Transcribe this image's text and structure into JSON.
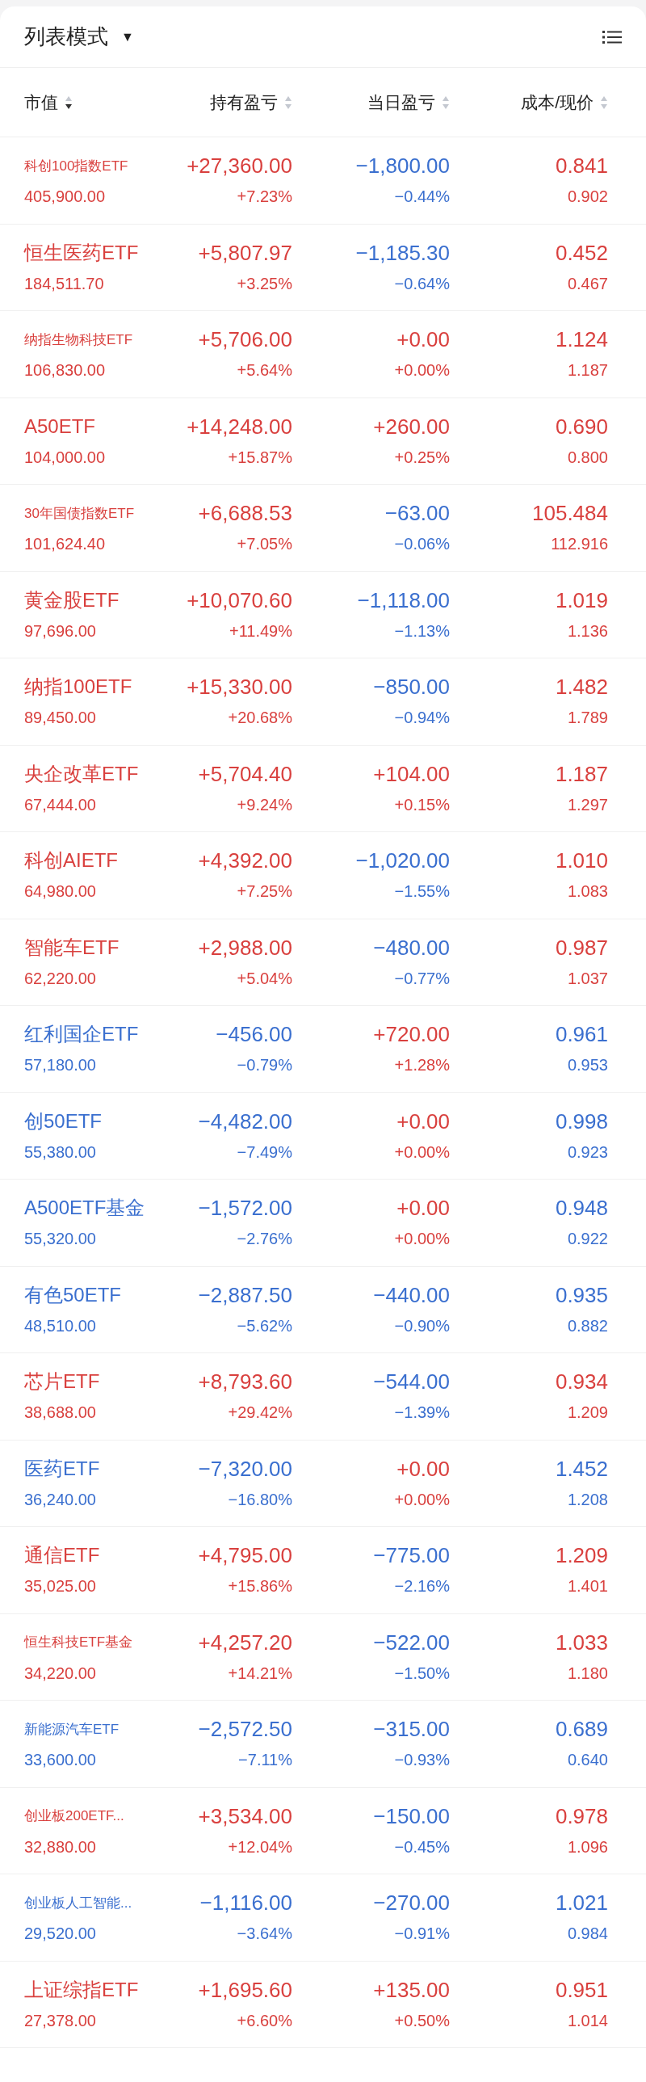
{
  "header": {
    "title": "列表模式",
    "dropdown_glyph": "▼"
  },
  "columns": [
    {
      "label": "市值",
      "sorted": true
    },
    {
      "label": "持有盈亏",
      "sorted": false
    },
    {
      "label": "当日盈亏",
      "sorted": false
    },
    {
      "label": "成本/现价",
      "sorted": false
    }
  ],
  "rows": [
    {
      "name": "科创100指数ETF",
      "market_value": "405,900.00",
      "hold_pnl": "+27,360.00",
      "hold_pct": "+7.23%",
      "hold_gain": true,
      "day_pnl": "−1,800.00",
      "day_pct": "−0.44%",
      "day_gain": false,
      "cost": "0.841",
      "price": "0.902",
      "price_gain": true
    },
    {
      "name": "恒生医药ETF",
      "market_value": "184,511.70",
      "hold_pnl": "+5,807.97",
      "hold_pct": "+3.25%",
      "hold_gain": true,
      "day_pnl": "−1,185.30",
      "day_pct": "−0.64%",
      "day_gain": false,
      "cost": "0.452",
      "price": "0.467",
      "price_gain": true
    },
    {
      "name": "纳指生物科技ETF",
      "market_value": "106,830.00",
      "hold_pnl": "+5,706.00",
      "hold_pct": "+5.64%",
      "hold_gain": true,
      "day_pnl": "+0.00",
      "day_pct": "+0.00%",
      "day_gain": true,
      "cost": "1.124",
      "price": "1.187",
      "price_gain": true
    },
    {
      "name": "A50ETF",
      "market_value": "104,000.00",
      "hold_pnl": "+14,248.00",
      "hold_pct": "+15.87%",
      "hold_gain": true,
      "day_pnl": "+260.00",
      "day_pct": "+0.25%",
      "day_gain": true,
      "cost": "0.690",
      "price": "0.800",
      "price_gain": true
    },
    {
      "name": "30年国债指数ETF",
      "market_value": "101,624.40",
      "hold_pnl": "+6,688.53",
      "hold_pct": "+7.05%",
      "hold_gain": true,
      "day_pnl": "−63.00",
      "day_pct": "−0.06%",
      "day_gain": false,
      "cost": "105.484",
      "price": "112.916",
      "price_gain": true
    },
    {
      "name": "黄金股ETF",
      "market_value": "97,696.00",
      "hold_pnl": "+10,070.60",
      "hold_pct": "+11.49%",
      "hold_gain": true,
      "day_pnl": "−1,118.00",
      "day_pct": "−1.13%",
      "day_gain": false,
      "cost": "1.019",
      "price": "1.136",
      "price_gain": true
    },
    {
      "name": "纳指100ETF",
      "market_value": "89,450.00",
      "hold_pnl": "+15,330.00",
      "hold_pct": "+20.68%",
      "hold_gain": true,
      "day_pnl": "−850.00",
      "day_pct": "−0.94%",
      "day_gain": false,
      "cost": "1.482",
      "price": "1.789",
      "price_gain": true
    },
    {
      "name": "央企改革ETF",
      "market_value": "67,444.00",
      "hold_pnl": "+5,704.40",
      "hold_pct": "+9.24%",
      "hold_gain": true,
      "day_pnl": "+104.00",
      "day_pct": "+0.15%",
      "day_gain": true,
      "cost": "1.187",
      "price": "1.297",
      "price_gain": true
    },
    {
      "name": "科创AIETF",
      "market_value": "64,980.00",
      "hold_pnl": "+4,392.00",
      "hold_pct": "+7.25%",
      "hold_gain": true,
      "day_pnl": "−1,020.00",
      "day_pct": "−1.55%",
      "day_gain": false,
      "cost": "1.010",
      "price": "1.083",
      "price_gain": true
    },
    {
      "name": "智能车ETF",
      "market_value": "62,220.00",
      "hold_pnl": "+2,988.00",
      "hold_pct": "+5.04%",
      "hold_gain": true,
      "day_pnl": "−480.00",
      "day_pct": "−0.77%",
      "day_gain": false,
      "cost": "0.987",
      "price": "1.037",
      "price_gain": true
    },
    {
      "name": "红利国企ETF",
      "market_value": "57,180.00",
      "hold_pnl": "−456.00",
      "hold_pct": "−0.79%",
      "hold_gain": false,
      "day_pnl": "+720.00",
      "day_pct": "+1.28%",
      "day_gain": true,
      "cost": "0.961",
      "price": "0.953",
      "price_gain": false
    },
    {
      "name": "创50ETF",
      "market_value": "55,380.00",
      "hold_pnl": "−4,482.00",
      "hold_pct": "−7.49%",
      "hold_gain": false,
      "day_pnl": "+0.00",
      "day_pct": "+0.00%",
      "day_gain": true,
      "cost": "0.998",
      "price": "0.923",
      "price_gain": false
    },
    {
      "name": "A500ETF基金",
      "market_value": "55,320.00",
      "hold_pnl": "−1,572.00",
      "hold_pct": "−2.76%",
      "hold_gain": false,
      "day_pnl": "+0.00",
      "day_pct": "+0.00%",
      "day_gain": true,
      "cost": "0.948",
      "price": "0.922",
      "price_gain": false
    },
    {
      "name": "有色50ETF",
      "market_value": "48,510.00",
      "hold_pnl": "−2,887.50",
      "hold_pct": "−5.62%",
      "hold_gain": false,
      "day_pnl": "−440.00",
      "day_pct": "−0.90%",
      "day_gain": false,
      "cost": "0.935",
      "price": "0.882",
      "price_gain": false
    },
    {
      "name": "芯片ETF",
      "market_value": "38,688.00",
      "hold_pnl": "+8,793.60",
      "hold_pct": "+29.42%",
      "hold_gain": true,
      "day_pnl": "−544.00",
      "day_pct": "−1.39%",
      "day_gain": false,
      "cost": "0.934",
      "price": "1.209",
      "price_gain": true
    },
    {
      "name": "医药ETF",
      "market_value": "36,240.00",
      "hold_pnl": "−7,320.00",
      "hold_pct": "−16.80%",
      "hold_gain": false,
      "day_pnl": "+0.00",
      "day_pct": "+0.00%",
      "day_gain": true,
      "cost": "1.452",
      "price": "1.208",
      "price_gain": false
    },
    {
      "name": "通信ETF",
      "market_value": "35,025.00",
      "hold_pnl": "+4,795.00",
      "hold_pct": "+15.86%",
      "hold_gain": true,
      "day_pnl": "−775.00",
      "day_pct": "−2.16%",
      "day_gain": false,
      "cost": "1.209",
      "price": "1.401",
      "price_gain": true
    },
    {
      "name": "恒生科技ETF基金",
      "market_value": "34,220.00",
      "hold_pnl": "+4,257.20",
      "hold_pct": "+14.21%",
      "hold_gain": true,
      "day_pnl": "−522.00",
      "day_pct": "−1.50%",
      "day_gain": false,
      "cost": "1.033",
      "price": "1.180",
      "price_gain": true
    },
    {
      "name": "新能源汽车ETF",
      "market_value": "33,600.00",
      "hold_pnl": "−2,572.50",
      "hold_pct": "−7.11%",
      "hold_gain": false,
      "day_pnl": "−315.00",
      "day_pct": "−0.93%",
      "day_gain": false,
      "cost": "0.689",
      "price": "0.640",
      "price_gain": false
    },
    {
      "name": "创业板200ETF...",
      "market_value": "32,880.00",
      "hold_pnl": "+3,534.00",
      "hold_pct": "+12.04%",
      "hold_gain": true,
      "day_pnl": "−150.00",
      "day_pct": "−0.45%",
      "day_gain": false,
      "cost": "0.978",
      "price": "1.096",
      "price_gain": true
    },
    {
      "name": "创业板人工智能...",
      "market_value": "29,520.00",
      "hold_pnl": "−1,116.00",
      "hold_pct": "−3.64%",
      "hold_gain": false,
      "day_pnl": "−270.00",
      "day_pct": "−0.91%",
      "day_gain": false,
      "cost": "1.021",
      "price": "0.984",
      "price_gain": false
    },
    {
      "name": "上证综指ETF",
      "market_value": "27,378.00",
      "hold_pnl": "+1,695.60",
      "hold_pct": "+6.60%",
      "hold_gain": true,
      "day_pnl": "+135.00",
      "day_pct": "+0.50%",
      "day_gain": true,
      "cost": "0.951",
      "price": "1.014",
      "price_gain": true
    }
  ]
}
